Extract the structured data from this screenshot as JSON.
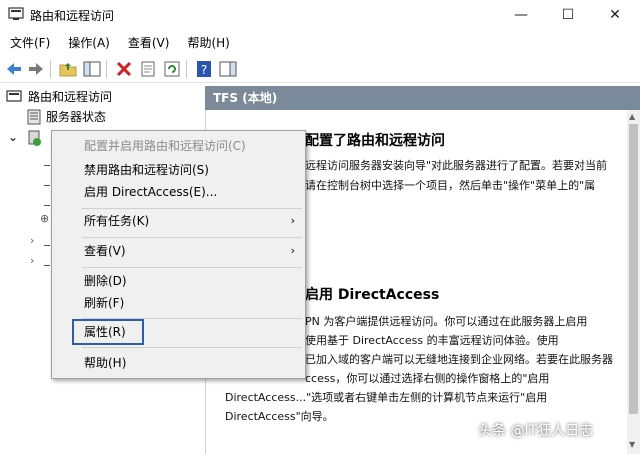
{
  "window": {
    "title": "路由和远程访问",
    "minimize": "—",
    "maximize": "☐",
    "close": "✕"
  },
  "menubar": [
    "文件(F)",
    "操作(A)",
    "查看(V)",
    "帮助(H)"
  ],
  "tree": {
    "root": "路由和远程访问",
    "server_status": "服务器状态"
  },
  "right": {
    "header": "TFS (本地)",
    "section1_title_visible": "配置了路由和远程访问",
    "section1_lines": [
      "远程访问服务器安装向导\"对此服务器进行了配置。若要对当前",
      "请在控制台树中选择一个项目，然后单击\"操作\"菜单上的\"属"
    ],
    "section2_title_visible": "启用 DirectAccess",
    "section2_lines": [
      "PN 为客户端提供远程访问。你可以通过在此服务器上启用",
      "使用基于 DirectAccess 的丰富远程访问体验。使用",
      "已加入域的客户端可以无缝地连接到企业网络。若要在此服务器",
      "ccess，你可以通过选择右侧的操作窗格上的\"启用",
      "DirectAccess...\"选项或者右键单击左侧的计算机节点来运行\"启用",
      "DirectAccess\"向导。"
    ]
  },
  "context_menu": {
    "items": [
      {
        "label": "配置并启用路由和远程访问(C)",
        "disabled": true
      },
      {
        "label": "禁用路由和远程访问(S)"
      },
      {
        "label": "启用 DirectAccess(E)..."
      },
      {
        "label": "所有任务(K)",
        "submenu": true
      },
      {
        "label": "查看(V)",
        "submenu": true
      },
      {
        "label": "删除(D)"
      },
      {
        "label": "刷新(F)"
      },
      {
        "label": "属性(R)",
        "highlighted": true
      },
      {
        "label": "帮助(H)"
      }
    ],
    "arrow": "›"
  },
  "watermark": "头条 @IT狂人日志",
  "colors": {
    "header_bg": "#7b8a98",
    "highlight_border": "#2b5eb3"
  }
}
